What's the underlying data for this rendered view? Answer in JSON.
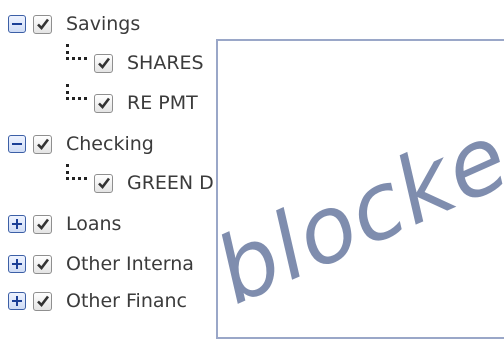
{
  "tree": {
    "groups": [
      {
        "label": "Savings",
        "expander": "minus-icon",
        "children": [
          "SHARES",
          "RE PMT"
        ]
      },
      {
        "label": "Checking",
        "expander": "minus-icon",
        "children": [
          "GREEN D"
        ]
      },
      {
        "label": "Loans",
        "expander": "plus-icon",
        "children": []
      },
      {
        "label": "Other Interna",
        "expander": "plus-icon",
        "children": []
      },
      {
        "label": "Other Financ",
        "expander": "plus-icon",
        "children": []
      }
    ]
  },
  "overlay": {
    "text": "blocked"
  },
  "colors": {
    "expander_border": "#3c5fa6",
    "expander_symbol": "#1b3f96",
    "text": "#3b3b3b",
    "overlay_text": "#7f8dae",
    "overlay_border": "#9aa7c8"
  }
}
